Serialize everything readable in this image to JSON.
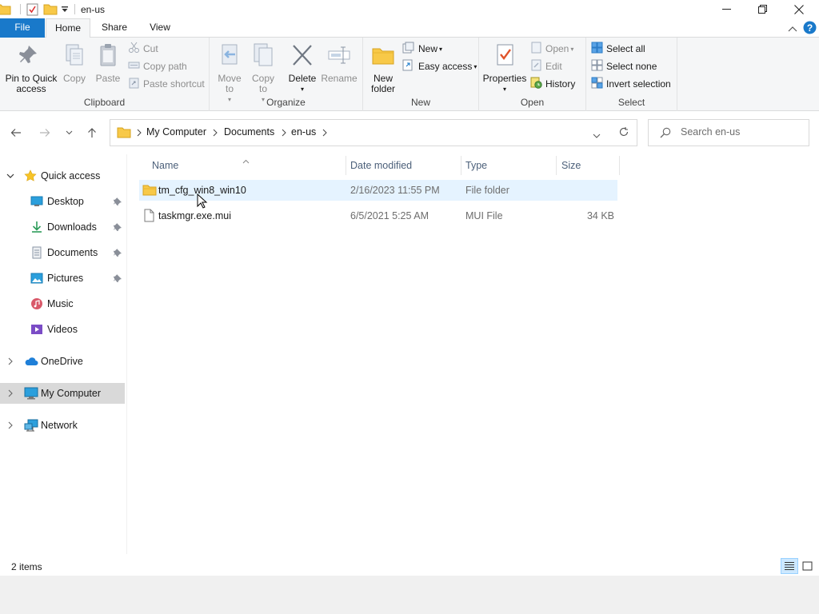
{
  "window": {
    "title": "en-us"
  },
  "tabs": {
    "file": "File",
    "home": "Home",
    "share": "Share",
    "view": "View"
  },
  "ribbon": {
    "clipboard": {
      "label": "Clipboard",
      "pin": "Pin to Quick access",
      "copy": "Copy",
      "paste": "Paste",
      "cut": "Cut",
      "copy_path": "Copy path",
      "paste_shortcut": "Paste shortcut"
    },
    "organize": {
      "label": "Organize",
      "move_to": "Move to",
      "copy_to": "Copy to",
      "delete": "Delete",
      "rename": "Rename"
    },
    "new": {
      "label": "New",
      "new_folder": "New folder",
      "new_item": "New",
      "easy_access": "Easy access"
    },
    "open": {
      "label": "Open",
      "properties": "Properties",
      "open": "Open",
      "edit": "Edit",
      "history": "History"
    },
    "select": {
      "label": "Select",
      "select_all": "Select all",
      "select_none": "Select none",
      "invert": "Invert selection"
    }
  },
  "address": {
    "crumbs": [
      "My Computer",
      "Documents",
      "en-us"
    ],
    "search_placeholder": "Search en-us"
  },
  "navpane": {
    "quick_access": "Quick access",
    "desktop": "Desktop",
    "downloads": "Downloads",
    "documents": "Documents",
    "pictures": "Pictures",
    "music": "Music",
    "videos": "Videos",
    "onedrive": "OneDrive",
    "my_computer": "My Computer",
    "network": "Network"
  },
  "columns": {
    "name": "Name",
    "date": "Date modified",
    "type": "Type",
    "size": "Size"
  },
  "files": [
    {
      "name": "tm_cfg_win8_win10",
      "date": "2/16/2023 11:55 PM",
      "type": "File folder",
      "size": ""
    },
    {
      "name": "taskmgr.exe.mui",
      "date": "6/5/2021 5:25 AM",
      "type": "MUI File",
      "size": "34 KB"
    }
  ],
  "status": {
    "count": "2 items"
  },
  "colors": {
    "accent": "#1979ca",
    "hover_row": "#e5f3ff",
    "selected_nav": "#d9d9d9",
    "folder": "#f8c948"
  }
}
